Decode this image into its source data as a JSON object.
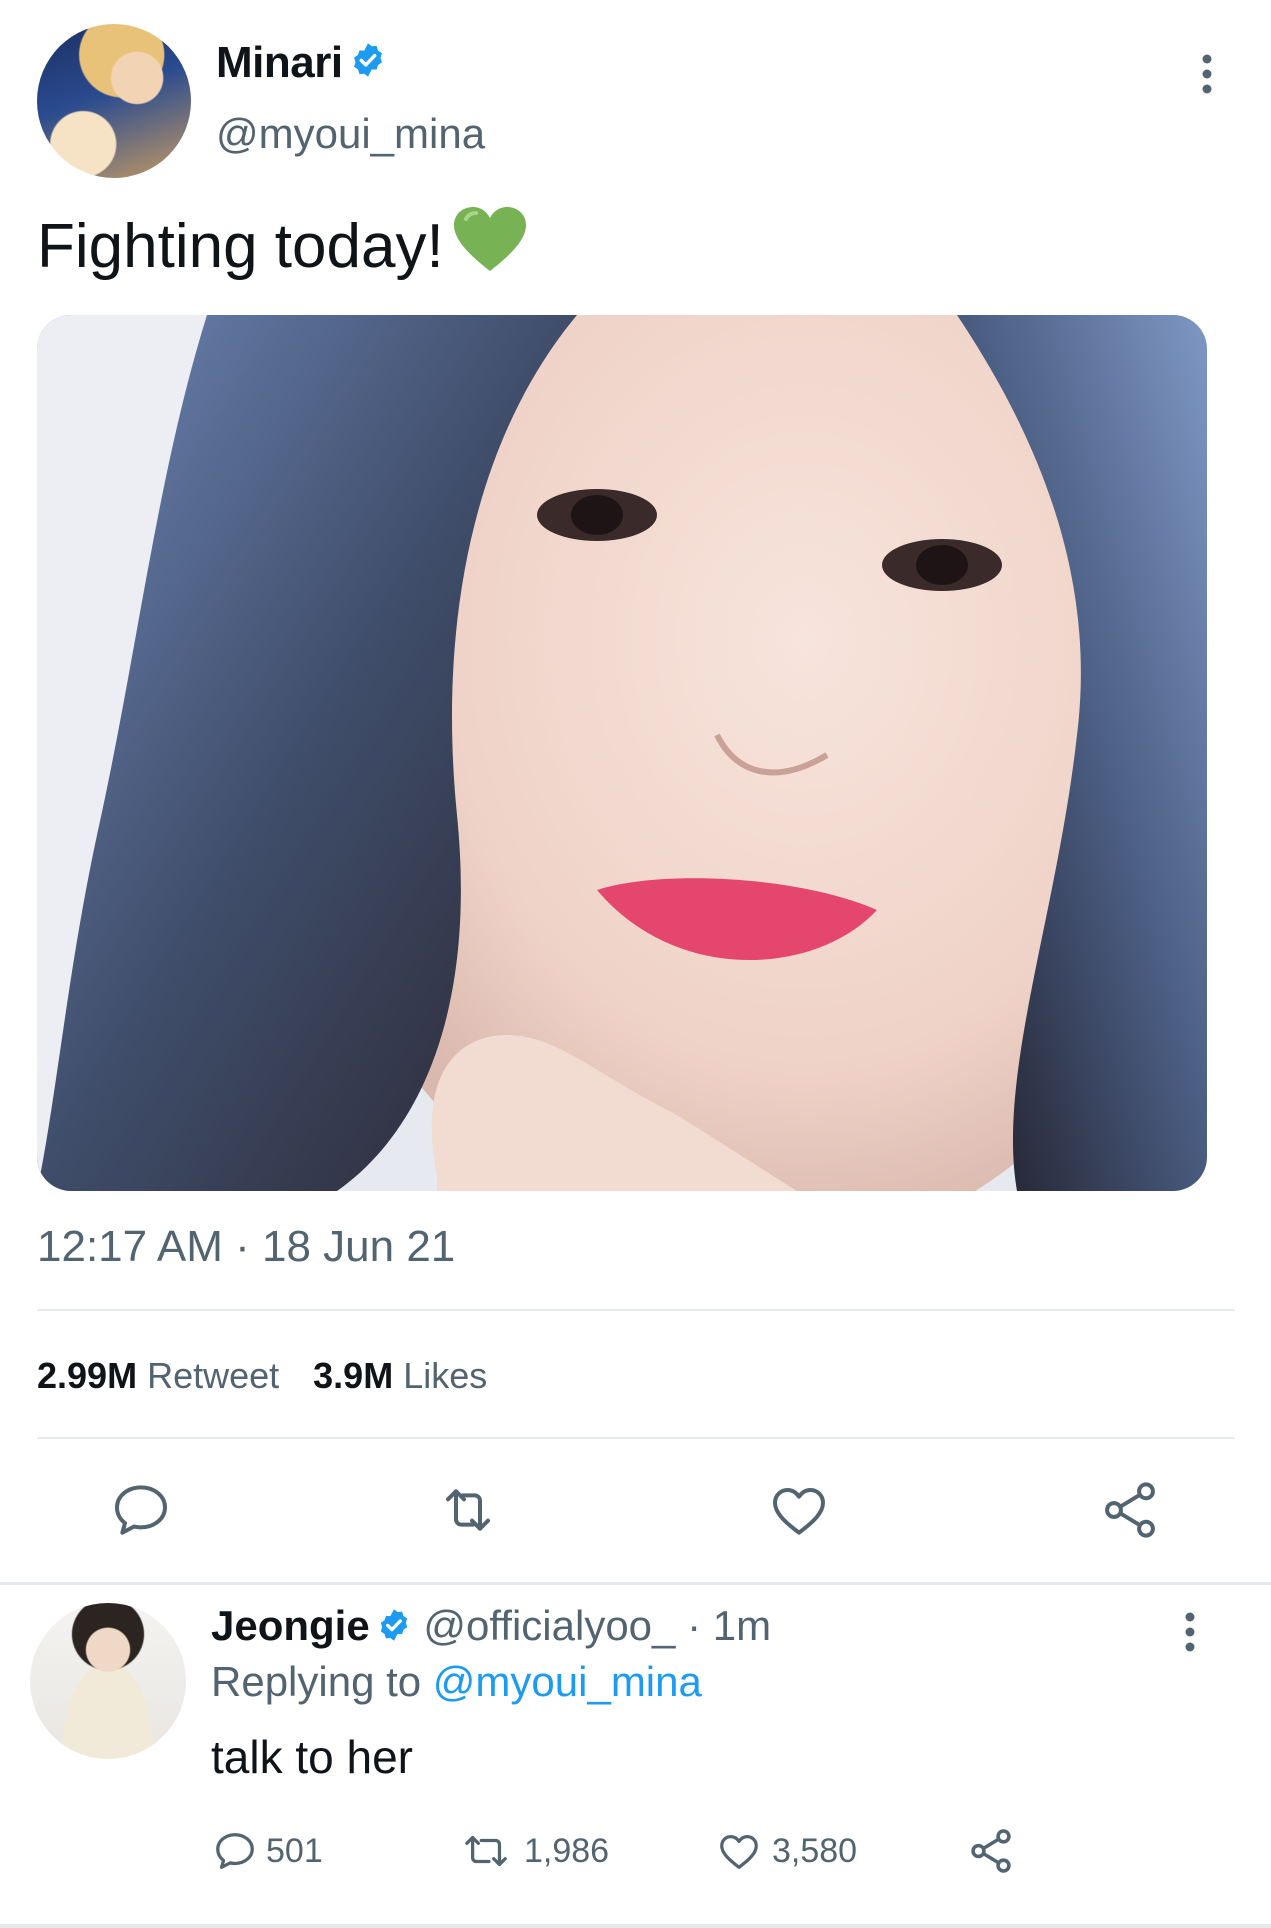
{
  "tweet": {
    "display_name": "Minari",
    "handle": "@myoui_mina",
    "text": "Fighting today!",
    "emoji_icon": "green-heart",
    "timestamp": "12:17 AM · 18 Jun 21",
    "stats": {
      "retweets_count": "2.99M",
      "retweets_label": "Retweet",
      "likes_count": "3.9M",
      "likes_label": "Likes"
    }
  },
  "reply": {
    "display_name": "Jeongie",
    "handle": "@officialyoo_",
    "time": "· 1m",
    "replying_prefix": "Replying to",
    "replying_handle": "@myoui_mina",
    "text": "talk to her",
    "counts": {
      "replies": "501",
      "retweets": "1,986",
      "likes": "3,580"
    }
  },
  "colors": {
    "accent": "#1d9bf0",
    "muted": "#536471",
    "text": "#0f1419",
    "divider": "#e6e9ec"
  }
}
